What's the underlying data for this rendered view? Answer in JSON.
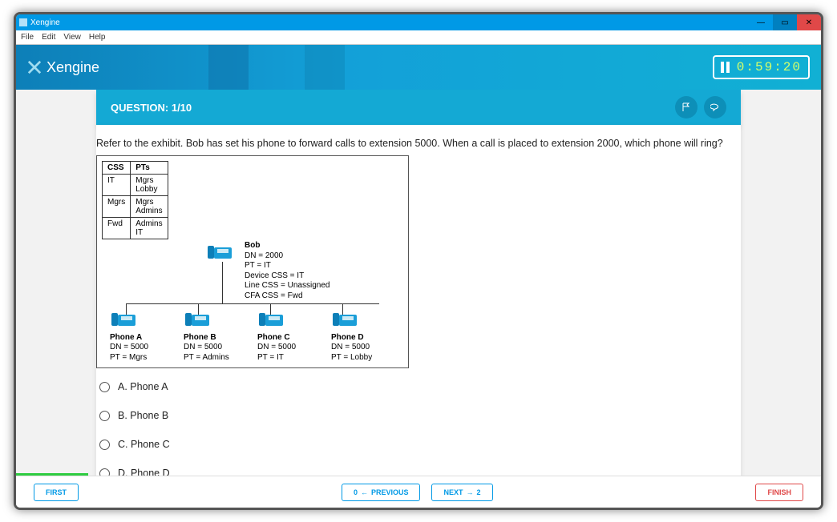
{
  "window": {
    "title": "Xengine"
  },
  "menubar": [
    "File",
    "Edit",
    "View",
    "Help"
  ],
  "header": {
    "brand": "Xengine",
    "timer": "0:59:20"
  },
  "question_bar": {
    "label": "QUESTION: 1/10"
  },
  "question": {
    "text": "Refer to the exhibit. Bob has set his phone to forward calls to extension 5000. When a call is placed to extension 2000, which phone will ring?"
  },
  "exhibit": {
    "table_headers": [
      "CSS",
      "PTs"
    ],
    "table_rows": [
      [
        "IT",
        "Mgrs\nLobby"
      ],
      [
        "Mgrs",
        "Mgrs\nAdmins"
      ],
      [
        "Fwd",
        "Admins\nIT"
      ]
    ],
    "bob": {
      "name": "Bob",
      "lines": [
        "DN = 2000",
        "PT = IT",
        "Device CSS = IT",
        "Line CSS = Unassigned",
        "CFA CSS = Fwd"
      ]
    },
    "phones": [
      {
        "name": "Phone A",
        "dn": "DN = 5000",
        "pt": "PT = Mgrs"
      },
      {
        "name": "Phone B",
        "dn": "DN = 5000",
        "pt": "PT = Admins"
      },
      {
        "name": "Phone C",
        "dn": "DN = 5000",
        "pt": "PT = IT"
      },
      {
        "name": "Phone D",
        "dn": "DN = 5000",
        "pt": "PT = Lobby"
      }
    ]
  },
  "options": [
    "A. Phone A",
    "B. Phone B",
    "C. Phone C",
    "D. Phone D"
  ],
  "footer": {
    "first": "FIRST",
    "prev_num": "0",
    "prev": "PREVIOUS",
    "next": "NEXT",
    "next_num": "2",
    "finish": "FINISH"
  }
}
